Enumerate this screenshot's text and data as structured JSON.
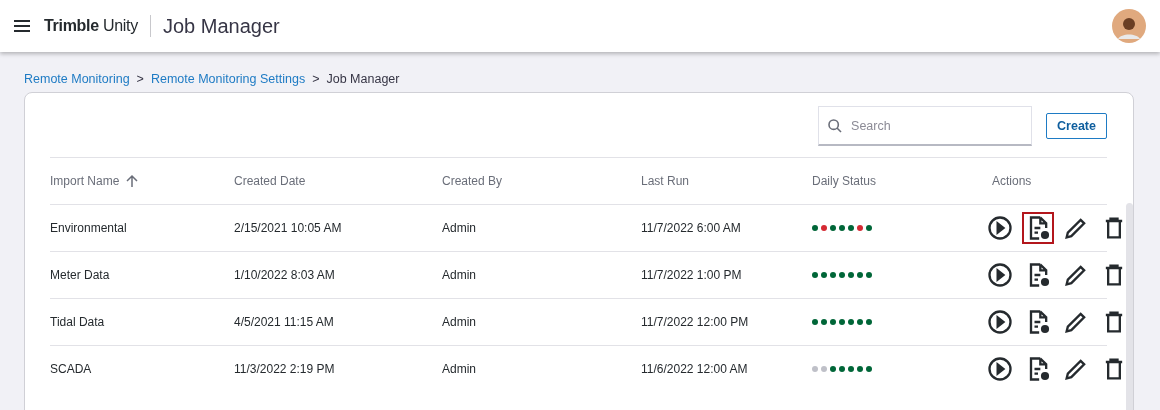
{
  "header": {
    "brand_bold": "Trimble",
    "brand_light": "Unity",
    "app_title": "Job Manager"
  },
  "breadcrumb": [
    {
      "label": "Remote Monitoring",
      "kind": "link"
    },
    {
      "label": ">",
      "kind": "sep"
    },
    {
      "label": "Remote Monitoring Settings",
      "kind": "link"
    },
    {
      "label": ">",
      "kind": "sep"
    },
    {
      "label": "Job Manager",
      "kind": "current"
    }
  ],
  "search": {
    "placeholder": "Search"
  },
  "create_button": "Create",
  "table": {
    "columns": [
      {
        "label": "Import Name",
        "sorted": true
      },
      {
        "label": "Created Date",
        "sorted": false
      },
      {
        "label": "Created By",
        "sorted": false
      },
      {
        "label": "Last Run",
        "sorted": false
      },
      {
        "label": "Daily Status",
        "sorted": false
      },
      {
        "label": "Actions",
        "sorted": false
      }
    ],
    "rows": [
      {
        "name": "Environmental",
        "created_date": "2/15/2021 10:05 AM",
        "created_by": "Admin",
        "last_run": "11/7/2022 6:00 AM",
        "status": [
          {
            "color": "#006638"
          },
          {
            "color": "#d52a33"
          },
          {
            "color": "#006638"
          },
          {
            "color": "#006638"
          },
          {
            "color": "#006638"
          },
          {
            "color": "#d52a33"
          },
          {
            "color": "#006638"
          }
        ],
        "actions": [
          {
            "kind": "run",
            "highlighted": false
          },
          {
            "kind": "log",
            "highlighted": true
          },
          {
            "kind": "edit",
            "highlighted": false
          },
          {
            "kind": "delete",
            "highlighted": false
          }
        ]
      },
      {
        "name": "Meter Data",
        "created_date": "1/10/2022 8:03 AM",
        "created_by": "Admin",
        "last_run": "11/7/2022 1:00 PM",
        "status": [
          {
            "color": "#006638"
          },
          {
            "color": "#006638"
          },
          {
            "color": "#006638"
          },
          {
            "color": "#006638"
          },
          {
            "color": "#006638"
          },
          {
            "color": "#006638"
          },
          {
            "color": "#006638"
          }
        ],
        "actions": [
          {
            "kind": "run",
            "highlighted": false
          },
          {
            "kind": "log",
            "highlighted": false
          },
          {
            "kind": "edit",
            "highlighted": false
          },
          {
            "kind": "delete",
            "highlighted": false
          }
        ]
      },
      {
        "name": "Tidal Data",
        "created_date": "4/5/2021 11:15 AM",
        "created_by": "Admin",
        "last_run": "11/7/2022 12:00 PM",
        "status": [
          {
            "color": "#006638"
          },
          {
            "color": "#006638"
          },
          {
            "color": "#006638"
          },
          {
            "color": "#006638"
          },
          {
            "color": "#006638"
          },
          {
            "color": "#006638"
          },
          {
            "color": "#006638"
          }
        ],
        "actions": [
          {
            "kind": "run",
            "highlighted": false
          },
          {
            "kind": "log",
            "highlighted": false
          },
          {
            "kind": "edit",
            "highlighted": false
          },
          {
            "kind": "delete",
            "highlighted": false
          }
        ]
      },
      {
        "name": "SCADA",
        "created_date": "11/3/2022 2:19 PM",
        "created_by": "Admin",
        "last_run": "11/6/2022 12:00 AM",
        "status": [
          {
            "color": "#bfc0c8"
          },
          {
            "color": "#bfc0c8"
          },
          {
            "color": "#006638"
          },
          {
            "color": "#006638"
          },
          {
            "color": "#006638"
          },
          {
            "color": "#006638"
          },
          {
            "color": "#006638"
          }
        ],
        "actions": [
          {
            "kind": "run",
            "highlighted": false
          },
          {
            "kind": "log",
            "highlighted": false
          },
          {
            "kind": "edit",
            "highlighted": false
          },
          {
            "kind": "delete",
            "highlighted": false
          }
        ]
      }
    ]
  }
}
